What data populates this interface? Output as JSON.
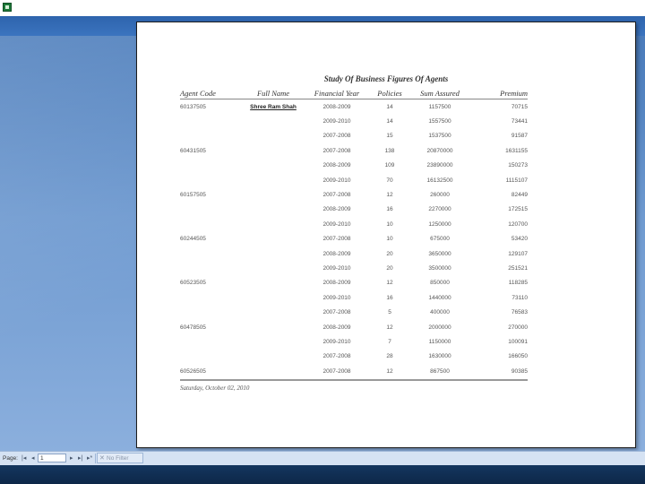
{
  "report": {
    "title": "Study Of Business Figures Of Agents",
    "columns": [
      "Agent Code",
      "Full Name",
      "Financial Year",
      "Policies",
      "Sum Assured",
      "Premium"
    ],
    "rows": [
      {
        "agent_code": "60137505",
        "full_name": "Shree Ram Shah",
        "year": "2008-2009",
        "policies": "14",
        "sum_assured": "1157500",
        "premium": "70715"
      },
      {
        "agent_code": "",
        "full_name": "",
        "year": "2009-2010",
        "policies": "14",
        "sum_assured": "1557500",
        "premium": "73441"
      },
      {
        "agent_code": "",
        "full_name": "",
        "year": "2007-2008",
        "policies": "15",
        "sum_assured": "1537500",
        "premium": "91587"
      },
      {
        "agent_code": "60431505",
        "full_name": "",
        "year": "2007-2008",
        "policies": "138",
        "sum_assured": "20870000",
        "premium": "1631155"
      },
      {
        "agent_code": "",
        "full_name": "",
        "year": "2008-2009",
        "policies": "109",
        "sum_assured": "23890000",
        "premium": "150273"
      },
      {
        "agent_code": "",
        "full_name": "",
        "year": "2009-2010",
        "policies": "70",
        "sum_assured": "16132500",
        "premium": "1115107"
      },
      {
        "agent_code": "60157505",
        "full_name": "",
        "year": "2007-2008",
        "policies": "12",
        "sum_assured": "260000",
        "premium": "82449"
      },
      {
        "agent_code": "",
        "full_name": "",
        "year": "2008-2009",
        "policies": "16",
        "sum_assured": "2270000",
        "premium": "172515"
      },
      {
        "agent_code": "",
        "full_name": "",
        "year": "2009-2010",
        "policies": "10",
        "sum_assured": "1250000",
        "premium": "120700"
      },
      {
        "agent_code": "60244505",
        "full_name": "",
        "year": "2007-2008",
        "policies": "10",
        "sum_assured": "675000",
        "premium": "53420"
      },
      {
        "agent_code": "",
        "full_name": "",
        "year": "2008-2009",
        "policies": "20",
        "sum_assured": "3650000",
        "premium": "129107"
      },
      {
        "agent_code": "",
        "full_name": "",
        "year": "2009-2010",
        "policies": "20",
        "sum_assured": "3500000",
        "premium": "251521"
      },
      {
        "agent_code": "60523505",
        "full_name": "",
        "year": "2008-2009",
        "policies": "12",
        "sum_assured": "850000",
        "premium": "118285"
      },
      {
        "agent_code": "",
        "full_name": "",
        "year": "2009-2010",
        "policies": "16",
        "sum_assured": "1440000",
        "premium": "73110"
      },
      {
        "agent_code": "",
        "full_name": "",
        "year": "2007-2008",
        "policies": "5",
        "sum_assured": "400000",
        "premium": "76583"
      },
      {
        "agent_code": "60478505",
        "full_name": "",
        "year": "2008-2009",
        "policies": "12",
        "sum_assured": "2000000",
        "premium": "270000"
      },
      {
        "agent_code": "",
        "full_name": "",
        "year": "2009-2010",
        "policies": "7",
        "sum_assured": "1150000",
        "premium": "100091"
      },
      {
        "agent_code": "",
        "full_name": "",
        "year": "2007-2008",
        "policies": "28",
        "sum_assured": "1630000",
        "premium": "166050"
      },
      {
        "agent_code": "60526505",
        "full_name": "",
        "year": "2007-2008",
        "policies": "12",
        "sum_assured": "867500",
        "premium": "90385"
      }
    ],
    "date": "Saturday, October 02, 2010"
  },
  "statusbar": {
    "page_label": "Page:",
    "page_value": "1",
    "filter_label": "No Filter",
    "nav_first": "|◂",
    "nav_prev": "◂",
    "nav_next": "▸",
    "nav_last": "▸|",
    "nav_extra": "▸*"
  },
  "icons": {
    "app": "excel-icon",
    "filter": "filter-icon"
  }
}
